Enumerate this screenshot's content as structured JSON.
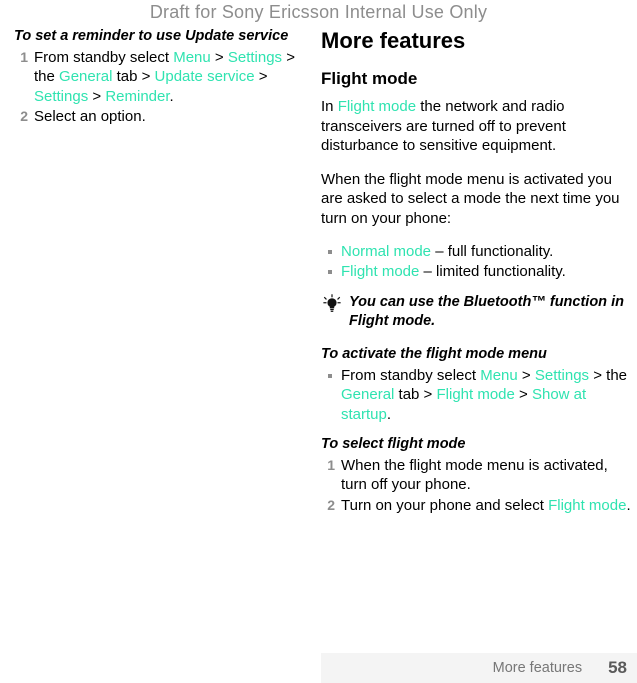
{
  "document": {
    "watermark": "Draft for Sony Ericsson Internal Use Only",
    "accent_color": "#2fe3b0",
    "muted_color": "#8d8d8d"
  },
  "left_column": {
    "procedure_heading": "To set a reminder to use Update service",
    "steps": [
      {
        "number": "1",
        "parts": [
          {
            "text": "From standby select ",
            "style": "plain"
          },
          {
            "text": "Menu",
            "style": "accent"
          },
          {
            "text": " > ",
            "style": "plain"
          },
          {
            "text": "Settings",
            "style": "accent"
          },
          {
            "text": " > the ",
            "style": "plain"
          },
          {
            "text": "General",
            "style": "accent"
          },
          {
            "text": " tab > ",
            "style": "plain"
          },
          {
            "text": "Update service",
            "style": "accent"
          },
          {
            "text": " > ",
            "style": "plain"
          },
          {
            "text": "Settings",
            "style": "accent"
          },
          {
            "text": " > ",
            "style": "plain"
          },
          {
            "text": "Reminder",
            "style": "accent"
          },
          {
            "text": ".",
            "style": "plain"
          }
        ]
      },
      {
        "number": "2",
        "parts": [
          {
            "text": "Select an option.",
            "style": "plain"
          }
        ]
      }
    ]
  },
  "right_column": {
    "chapter_title": "More features",
    "section_title": "Flight mode",
    "intro_paragraph": [
      {
        "text": "In ",
        "style": "plain"
      },
      {
        "text": "Flight mode",
        "style": "accent"
      },
      {
        "text": " the network and radio transceivers are turned off to prevent disturbance to sensitive equipment.",
        "style": "plain"
      }
    ],
    "second_paragraph": [
      {
        "text": "When the flight mode menu is activated you are asked to select a mode the next time you turn on your phone:",
        "style": "plain"
      }
    ],
    "mode_bullets": [
      [
        {
          "text": "Normal mode",
          "style": "accent"
        },
        {
          "text": " – full functionality.",
          "style": "plain"
        }
      ],
      [
        {
          "text": "Flight mode",
          "style": "accent"
        },
        {
          "text": " – limited functionality.",
          "style": "plain"
        }
      ]
    ],
    "tip": {
      "icon": "lightbulb-icon",
      "text": "You can use the Bluetooth™ function in Flight mode."
    },
    "activate_heading": "To activate the flight mode menu",
    "activate_bullets": [
      [
        {
          "text": "From standby select ",
          "style": "plain"
        },
        {
          "text": "Menu",
          "style": "accent"
        },
        {
          "text": " > ",
          "style": "plain"
        },
        {
          "text": "Settings",
          "style": "accent"
        },
        {
          "text": " > the ",
          "style": "plain"
        },
        {
          "text": "General",
          "style": "accent"
        },
        {
          "text": " tab > ",
          "style": "plain"
        },
        {
          "text": "Flight mode",
          "style": "accent"
        },
        {
          "text": " > ",
          "style": "plain"
        },
        {
          "text": "Show at startup",
          "style": "accent"
        },
        {
          "text": ".",
          "style": "plain"
        }
      ]
    ],
    "select_heading": "To select flight mode",
    "select_steps": [
      {
        "number": "1",
        "parts": [
          {
            "text": "When the flight mode menu is activated, turn off your phone.",
            "style": "plain"
          }
        ]
      },
      {
        "number": "2",
        "parts": [
          {
            "text": "Turn on your phone and select ",
            "style": "plain"
          },
          {
            "text": "Flight mode",
            "style": "accent"
          },
          {
            "text": ".",
            "style": "plain"
          }
        ]
      }
    ]
  },
  "footer": {
    "section_label": "More features",
    "page_number": "58"
  }
}
